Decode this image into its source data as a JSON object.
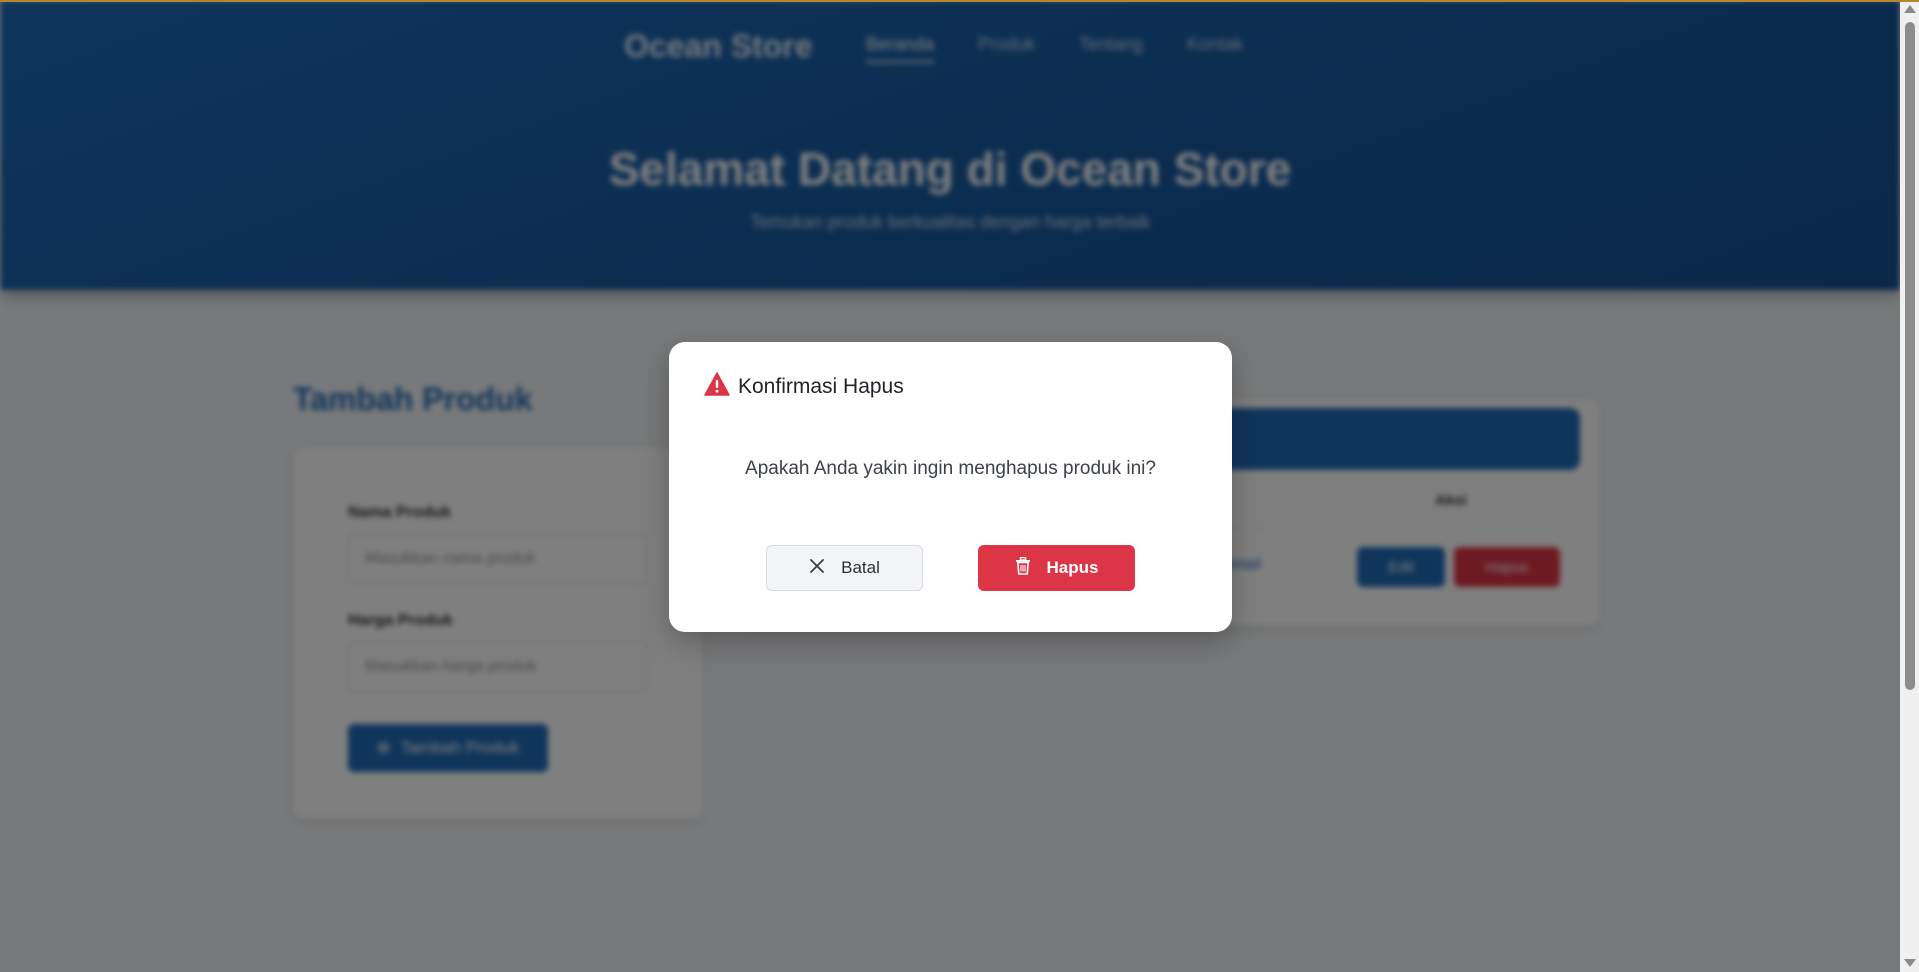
{
  "colors": {
    "primary": "#1f6ab7",
    "danger": "#dc3545",
    "overlay": "rgba(0,0,0,0.5)",
    "top_accent": "#b3872f"
  },
  "background_page": {
    "brand": "Ocean Store",
    "nav": [
      "Beranda",
      "Produk",
      "Tentang",
      "Kontak"
    ],
    "active_nav": "Beranda",
    "hero": {
      "title": "Selamat Datang di Ocean Store",
      "subtitle": "Temukan produk berkualitas dengan harga terbaik"
    },
    "form": {
      "title": "Tambah Produk",
      "name_label": "Nama Produk",
      "name_placeholder": "Masukkan nama produk",
      "price_label": "Harga Produk",
      "price_placeholder": "Masukkan harga produk",
      "submit_label": "Tambah Produk"
    },
    "list": {
      "aksi_header": "Aksi",
      "row_link": "Detail",
      "edit_label": "Edit",
      "delete_label": "Hapus"
    }
  },
  "modal": {
    "icon": "warning-triangle-icon",
    "title": "Konfirmasi Hapus",
    "message": "Apakah Anda yakin ingin menghapus produk ini?",
    "cancel_label": "Batal",
    "cancel_icon": "close-icon",
    "confirm_label": "Hapus",
    "confirm_icon": "trash-icon"
  }
}
